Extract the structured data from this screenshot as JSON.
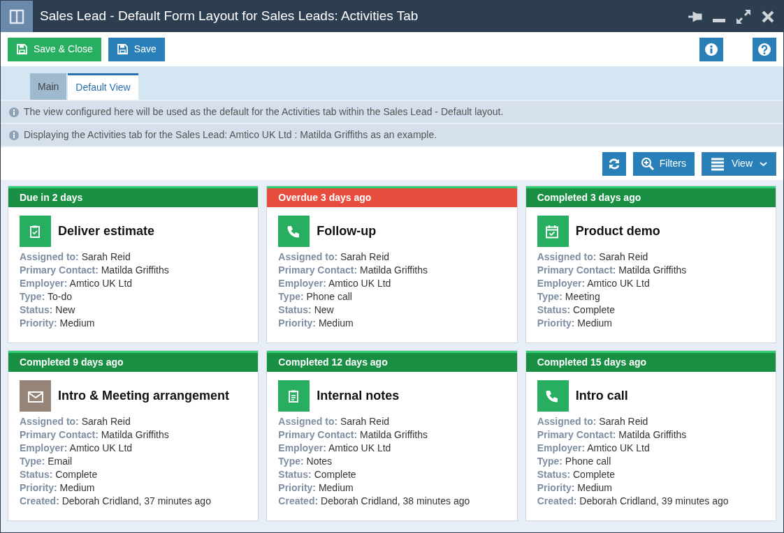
{
  "window": {
    "title": "Sales Lead - Default Form Layout for Sales Leads: Activities Tab"
  },
  "toolbar": {
    "buttons": [
      {
        "kind": "save-close",
        "label": "Save & Close"
      },
      {
        "kind": "save",
        "label": "Save"
      }
    ]
  },
  "tabs": [
    {
      "label": "Main",
      "selected": false
    },
    {
      "label": "Default View",
      "selected": true
    }
  ],
  "notices": [
    "The view configured here will be used as the default for the Activities tab within the Sales Lead - Default layout.",
    "Displaying the Activities tab for the Sales Lead: Amtico UK Ltd : Matilda Griffiths as an example."
  ],
  "view_toolbar": {
    "filters_label": "Filters",
    "view_label": "View"
  },
  "activities": [
    {
      "status": "Due in 2 days",
      "color": "#188f43",
      "kind": "todo",
      "title": "Deliver estimate",
      "fields": [
        {
          "label": "Assigned to:",
          "value": "Sarah Reid"
        },
        {
          "label": "Primary Contact:",
          "value": "Matilda Griffiths"
        },
        {
          "label": "Employer:",
          "value": "Amtico UK Ltd"
        },
        {
          "label": "Type:",
          "value": "To-do"
        },
        {
          "label": "Status:",
          "value": "New"
        },
        {
          "label": "Priority:",
          "value": "Medium"
        }
      ]
    },
    {
      "status": "Overdue 3 days ago",
      "color": "#e74c3c",
      "kind": "phone",
      "title": "Follow-up",
      "fields": [
        {
          "label": "Assigned to:",
          "value": "Sarah Reid"
        },
        {
          "label": "Primary Contact:",
          "value": "Matilda Griffiths"
        },
        {
          "label": "Employer:",
          "value": "Amtico UK Ltd"
        },
        {
          "label": "Type:",
          "value": "Phone call"
        },
        {
          "label": "Status:",
          "value": "New"
        },
        {
          "label": "Priority:",
          "value": "Medium"
        }
      ]
    },
    {
      "status": "Completed 3 days ago",
      "color": "#188f43",
      "kind": "meeting",
      "title": "Product demo",
      "fields": [
        {
          "label": "Assigned to:",
          "value": "Sarah Reid"
        },
        {
          "label": "Primary Contact:",
          "value": "Matilda Griffiths"
        },
        {
          "label": "Employer:",
          "value": "Amtico UK Ltd"
        },
        {
          "label": "Type:",
          "value": "Meeting"
        },
        {
          "label": "Status:",
          "value": "Complete"
        },
        {
          "label": "Priority:",
          "value": "Medium"
        }
      ]
    },
    {
      "status": "Completed 9 days ago",
      "color": "#188f43",
      "kind": "email",
      "title": "Intro & Meeting arrangement",
      "fields": [
        {
          "label": "Assigned to:",
          "value": "Sarah Reid"
        },
        {
          "label": "Primary Contact:",
          "value": "Matilda Griffiths"
        },
        {
          "label": "Employer:",
          "value": "Amtico UK Ltd"
        },
        {
          "label": "Type:",
          "value": "Email"
        },
        {
          "label": "Status:",
          "value": "Complete"
        },
        {
          "label": "Priority:",
          "value": "Medium"
        },
        {
          "label": "Created:",
          "value": "Deborah Cridland, 37 minutes ago"
        }
      ]
    },
    {
      "status": "Completed 12 days ago",
      "color": "#188f43",
      "kind": "notes",
      "title": "Internal notes",
      "fields": [
        {
          "label": "Assigned to:",
          "value": "Sarah Reid"
        },
        {
          "label": "Primary Contact:",
          "value": "Matilda Griffiths"
        },
        {
          "label": "Employer:",
          "value": "Amtico UK Ltd"
        },
        {
          "label": "Type:",
          "value": "Notes"
        },
        {
          "label": "Status:",
          "value": "Complete"
        },
        {
          "label": "Priority:",
          "value": "Medium"
        },
        {
          "label": "Created:",
          "value": "Deborah Cridland, 38 minutes ago"
        }
      ]
    },
    {
      "status": "Completed 15 days ago",
      "color": "#188f43",
      "kind": "phone",
      "title": "Intro call",
      "fields": [
        {
          "label": "Assigned to:",
          "value": "Sarah Reid"
        },
        {
          "label": "Primary Contact:",
          "value": "Matilda Griffiths"
        },
        {
          "label": "Employer:",
          "value": "Amtico UK Ltd"
        },
        {
          "label": "Type:",
          "value": "Phone call"
        },
        {
          "label": "Status:",
          "value": "Complete"
        },
        {
          "label": "Priority:",
          "value": "Medium"
        },
        {
          "label": "Created:",
          "value": "Deborah Cridland, 39 minutes ago"
        }
      ]
    }
  ]
}
